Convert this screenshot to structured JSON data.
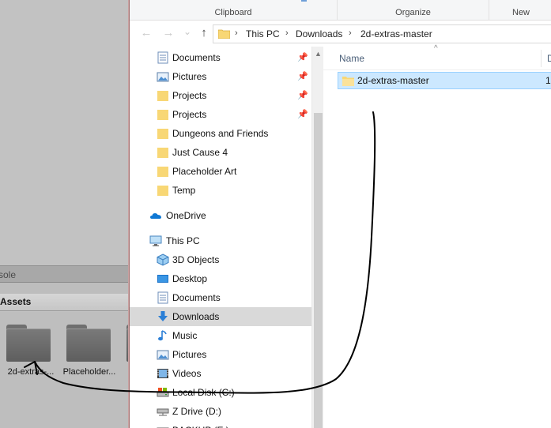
{
  "unity": {
    "console_tab": "sole",
    "assets_title": "Assets",
    "folders": [
      {
        "label": "2d-extras-..."
      },
      {
        "label": "Placeholder..."
      }
    ]
  },
  "ribbon": {
    "clipboard": "Clipboard",
    "organize": "Organize",
    "new": "New"
  },
  "nav": {
    "back": "←",
    "forward": "→",
    "recent": "⌄",
    "up": "↑"
  },
  "breadcrumb": {
    "items": [
      "This PC",
      "Downloads",
      "2d-extras-master"
    ],
    "separator": "›"
  },
  "navpane": {
    "items": [
      {
        "label": "Documents",
        "icon": "documents-icon",
        "pinned": true
      },
      {
        "label": "Pictures",
        "icon": "pictures-icon",
        "pinned": true
      },
      {
        "label": "Projects",
        "icon": "folder-icon",
        "pinned": true
      },
      {
        "label": "Projects",
        "icon": "folder-icon",
        "pinned": true
      },
      {
        "label": "Dungeons and Friends",
        "icon": "folder-icon",
        "pinned": false
      },
      {
        "label": "Just Cause 4",
        "icon": "folder-icon",
        "pinned": false
      },
      {
        "label": "Placeholder Art",
        "icon": "folder-icon",
        "pinned": false
      },
      {
        "label": "Temp",
        "icon": "folder-icon",
        "pinned": false
      },
      {
        "label": "OneDrive",
        "icon": "onedrive-icon",
        "pinned": false
      },
      {
        "label": "This PC",
        "icon": "this-pc-icon",
        "pinned": false
      },
      {
        "label": "3D Objects",
        "icon": "3d-objects-icon",
        "pinned": false
      },
      {
        "label": "Desktop",
        "icon": "desktop-icon",
        "pinned": false
      },
      {
        "label": "Documents",
        "icon": "documents-icon",
        "pinned": false
      },
      {
        "label": "Downloads",
        "icon": "downloads-icon",
        "pinned": false,
        "selected": true
      },
      {
        "label": "Music",
        "icon": "music-icon",
        "pinned": false
      },
      {
        "label": "Pictures",
        "icon": "pictures-icon",
        "pinned": false
      },
      {
        "label": "Videos",
        "icon": "videos-icon",
        "pinned": false
      },
      {
        "label": "Local Disk (C:)",
        "icon": "local-disk-icon",
        "pinned": false
      },
      {
        "label": "Z Drive (D:)",
        "icon": "network-drive-icon",
        "pinned": false
      },
      {
        "label": "BACKUP (E:)",
        "icon": "drive-icon",
        "pinned": false
      }
    ],
    "pin_glyph": "📌"
  },
  "content": {
    "columns": {
      "name": "Name",
      "date": "D"
    },
    "sort_glyph": "^",
    "files": [
      {
        "name": "2d-extras-master",
        "extra": "1",
        "selected": true
      }
    ]
  },
  "colors": {
    "selection": "#cce8ff",
    "selection_border": "#99d1ff",
    "folder": "#f8d775",
    "folder_dark": "#e0b84a",
    "accent": "#0078d7"
  }
}
